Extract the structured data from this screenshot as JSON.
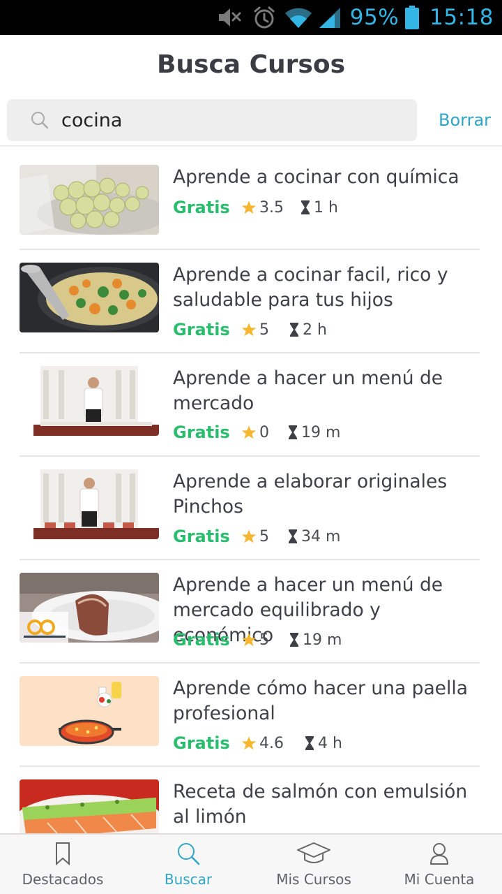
{
  "status_bar": {
    "battery": "95%",
    "time": "15:18",
    "icons": [
      "mute-icon",
      "alarm-icon",
      "wifi-icon",
      "signal-icon",
      "battery-icon"
    ]
  },
  "header": {
    "title": "Busca Cursos"
  },
  "search": {
    "value": "cocina",
    "clear_label": "Borrar",
    "icon": "search-icon"
  },
  "courses": [
    {
      "title": "Aprende a cocinar con química",
      "price": "Gratis",
      "rating": "3.5",
      "duration": "1 h",
      "thumb": "spheres"
    },
    {
      "title": "Aprende a cocinar facil, rico y saludable para tus hijos",
      "price": "Gratis",
      "rating": "5",
      "duration": "2 h",
      "thumb": "pan-food"
    },
    {
      "title": "Aprende a hacer un menú de mercado",
      "price": "Gratis",
      "rating": "0",
      "duration": "19 m",
      "thumb": "chef"
    },
    {
      "title": "Aprende a elaborar originales Pinchos",
      "price": "Gratis",
      "rating": "5",
      "duration": "34 m",
      "thumb": "chef"
    },
    {
      "title": "Aprende a hacer un menú de mercado equilibrado y económico",
      "price": "Gratis",
      "rating": "5",
      "duration": "19 m",
      "thumb": "meat-plate"
    },
    {
      "title": "Aprende cómo hacer una paella profesional",
      "price": "Gratis",
      "rating": "4.6",
      "duration": "4 h",
      "thumb": "paella"
    },
    {
      "title": "Receta de salmón con emulsión al limón",
      "price": "",
      "rating": "",
      "duration": "",
      "thumb": "salmon"
    }
  ],
  "bottom_nav": [
    {
      "label": "Destacados",
      "icon": "bookmark-icon",
      "active": false
    },
    {
      "label": "Buscar",
      "icon": "search-icon",
      "active": true
    },
    {
      "label": "Mis Cursos",
      "icon": "graduation-cap-icon",
      "active": false
    },
    {
      "label": "Mi Cuenta",
      "icon": "user-icon",
      "active": false
    }
  ],
  "colors": {
    "accent": "#2fa6c5",
    "price_green": "#2bbd6e",
    "star": "#f5b731",
    "status_blue": "#33b5e5"
  }
}
